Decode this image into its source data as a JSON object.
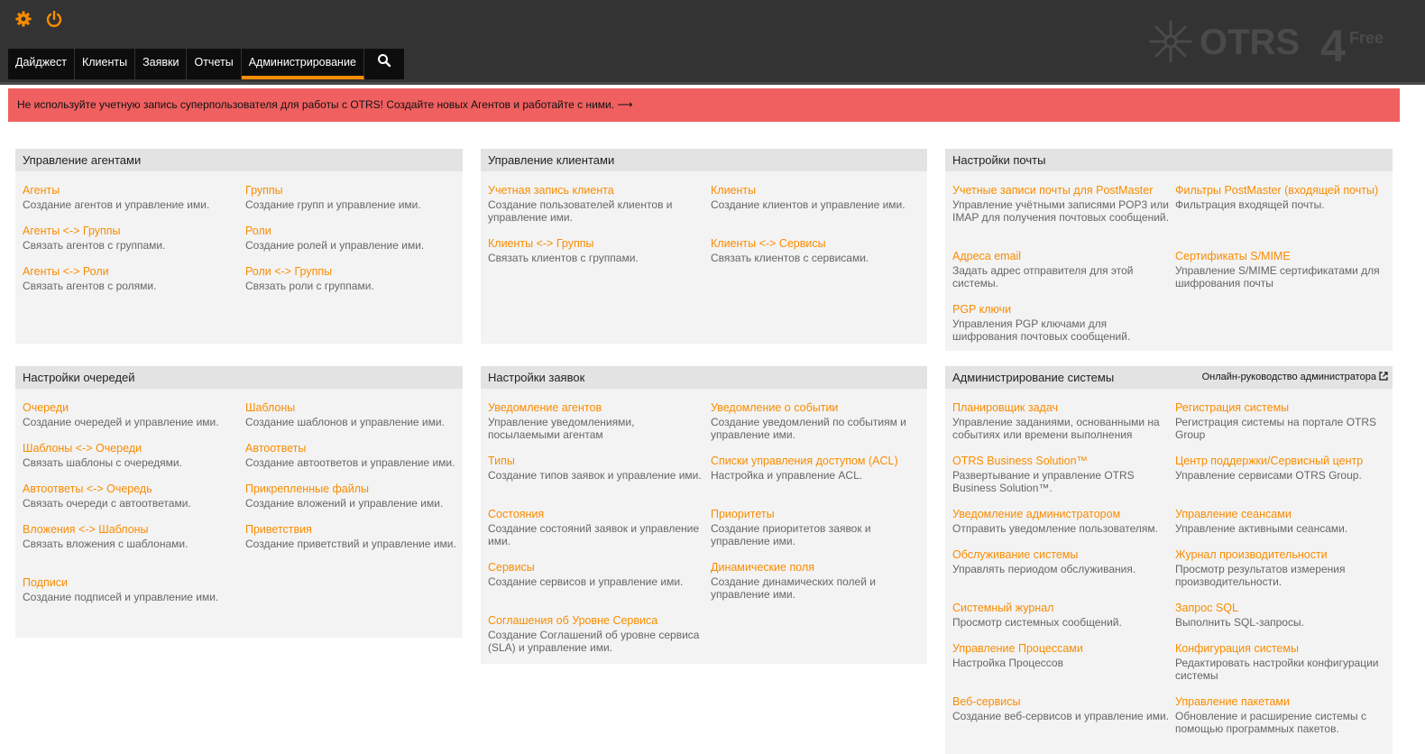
{
  "header": {
    "nav": [
      "Дайджест",
      "Клиенты",
      "Заявки",
      "Отчеты",
      "Администрирование"
    ],
    "active_index": 4,
    "logo_text": "OTRS",
    "logo_version": "4",
    "logo_edition": "Free"
  },
  "icons": {
    "gear": "gear-icon",
    "power": "power-icon",
    "search": "search-icon",
    "external": "external-link-icon",
    "accent_color": "#f98c00",
    "notice_color": "#f06060"
  },
  "notice": {
    "text": "Не используйте учетную запись суперпользователя для работы с OTRS! Создайте новых Агентов и работайте с ними. ⟶"
  },
  "widgets": [
    {
      "title": "Управление агентами",
      "items": [
        {
          "link": "Агенты",
          "desc": "Создание агентов и управление ими."
        },
        {
          "link": "Группы",
          "desc": "Создание групп и управление ими."
        },
        {
          "link": "Агенты <-> Группы",
          "desc": "Связать агентов с группами."
        },
        {
          "link": "Роли",
          "desc": "Создание ролей и управление ими."
        },
        {
          "link": "Агенты <-> Роли",
          "desc": "Связать агентов с ролями."
        },
        {
          "link": "Роли <-> Группы",
          "desc": "Связать роли с группами."
        }
      ]
    },
    {
      "title": "Управление клиентами",
      "items": [
        {
          "link": "Учетная запись клиента",
          "desc": "Создание пользователей клиентов и управление ими."
        },
        {
          "link": "Клиенты",
          "desc": "Создание клиентов и управление ими."
        },
        {
          "link": "Клиенты <-> Группы",
          "desc": "Связать клиентов с группами."
        },
        {
          "link": "Клиенты <-> Сервисы",
          "desc": "Связать клиентов с сервисами."
        }
      ]
    },
    {
      "title": "Настройки почты",
      "items": [
        {
          "link": "Учетные записи почты для PostMaster",
          "desc": "Управление учётными записями POP3 или IMAP для получения почтовых сообщений."
        },
        {
          "link": "Фильтры PostMaster (входящей почты)",
          "desc": "Фильтрация входящей почты."
        },
        {
          "link": "Адреса email",
          "desc": "Задать адрес отправителя для этой системы."
        },
        {
          "link": "Сертификаты S/MIME",
          "desc": "Управление S/MIME сертификатами для шифрования почты"
        },
        {
          "link": "PGP ключи",
          "desc": "Управления PGP ключами для шифрования почтовых сообщений."
        }
      ]
    },
    {
      "title": "Настройки очередей",
      "items": [
        {
          "link": "Очереди",
          "desc": "Создание очередей и управление ими."
        },
        {
          "link": "Шаблоны",
          "desc": "Создание шаблонов и управление ими."
        },
        {
          "link": "Шаблоны <-> Очереди",
          "desc": "Связать шаблоны с очередями."
        },
        {
          "link": "Автоответы",
          "desc": "Создание автоответов и управление ими."
        },
        {
          "link": "Автоответы <-> Очередь",
          "desc": "Связать очереди с автоответами."
        },
        {
          "link": "Прикрепленные файлы",
          "desc": "Создание вложений и управление ими."
        },
        {
          "link": "Вложения <-> Шаблоны",
          "desc": "Связать вложения с шаблонами."
        },
        {
          "link": "Приветствия",
          "desc": "Создание приветствий и управление ими."
        },
        {
          "link": "Подписи",
          "desc": "Создание подписей и управление ими."
        }
      ]
    },
    {
      "title": "Настройки заявок",
      "items": [
        {
          "link": "Уведомление агентов",
          "desc": "Управление уведомлениями, посылаемыми агентам"
        },
        {
          "link": "Уведомление о событии",
          "desc": "Создание уведомлений по событиям и управление ими."
        },
        {
          "link": "Типы",
          "desc": "Создание типов заявок и управление ими."
        },
        {
          "link": "Списки управления доступом (ACL)",
          "desc": "Настройка и управление ACL."
        },
        {
          "link": "Состояния",
          "desc": "Создание состояний заявок и управление ими."
        },
        {
          "link": "Приоритеты",
          "desc": "Создание приоритетов заявок и управление ими."
        },
        {
          "link": "Сервисы",
          "desc": "Создание сервисов и управление ими."
        },
        {
          "link": "Динамические поля",
          "desc": "Создание динамических полей и управление ими."
        },
        {
          "link": "Соглашения об Уровне Сервиса",
          "desc": "Создание Соглашений об уровне сервиса (SLA) и управление ими."
        }
      ]
    },
    {
      "title": "Администрирование системы",
      "head_link": "Онлайн-руководство администратора",
      "items": [
        {
          "link": "Планировщик задач",
          "desc": "Управление заданиями, основанными на событиях или времени выполнения"
        },
        {
          "link": "Регистрация системы",
          "desc": "Регистрация системы на портале OTRS Group"
        },
        {
          "link": "OTRS Business Solution™",
          "desc": "Развертывание и управление OTRS Business Solution™."
        },
        {
          "link": "Центр поддержки/Сервисный центр",
          "desc": "Управление сервисами OTRS Group."
        },
        {
          "link": "Уведомление администратором",
          "desc": "Отправить уведомление пользователям."
        },
        {
          "link": "Управление сеансами",
          "desc": "Управление активными сеансами."
        },
        {
          "link": "Обслуживание системы",
          "desc": "Управлять периодом обслуживания."
        },
        {
          "link": "Журнал производительности",
          "desc": "Просмотр результатов измерения производительности."
        },
        {
          "link": "Системный журнал",
          "desc": "Просмотр системных сообщений."
        },
        {
          "link": "Запрос SQL",
          "desc": "Выполнить SQL-запросы."
        },
        {
          "link": "Управление Процессами",
          "desc": "Настройка Процессов"
        },
        {
          "link": "Конфигурация системы",
          "desc": "Редактировать настройки конфигурации системы"
        },
        {
          "link": "Веб-сервисы",
          "desc": "Создание веб-сервисов и управление ими."
        },
        {
          "link": "Управление пакетами",
          "desc": "Обновление и расширение системы с помощью программных пакетов."
        }
      ]
    }
  ]
}
